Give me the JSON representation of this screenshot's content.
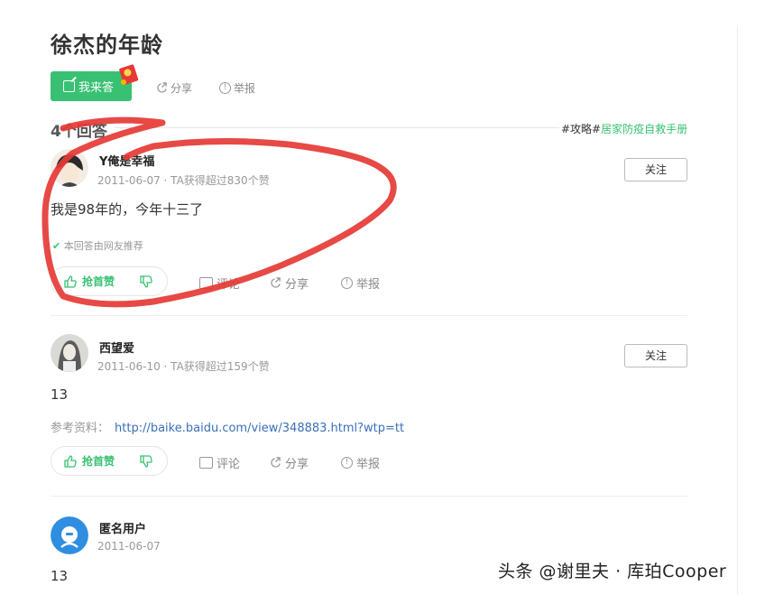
{
  "question": {
    "title": "徐杰的年龄",
    "answer_button": "我来答",
    "share": "分享",
    "report": "举报"
  },
  "answers_header": {
    "count": "4个回答",
    "tag_prefix": "#攻略#",
    "tag_link": "居家防疫自救手册"
  },
  "answers": [
    {
      "user": "Y俺是幸福",
      "meta": "2011-06-07 · TA获得超过830个赞",
      "follow": "关注",
      "content": "我是98年的，今年十三了",
      "note": "本回答由网友推荐",
      "vote_label": "抢首赞",
      "comment": "评论",
      "share": "分享",
      "report": "举报"
    },
    {
      "user": "西望爱",
      "meta": "2011-06-10 · TA获得超过159个赞",
      "follow": "关注",
      "content": "13",
      "ref_label": "参考资料：",
      "ref_link": "http://baike.baidu.com/view/348883.html?wtp=tt",
      "vote_label": "抢首赞",
      "comment": "评论",
      "share": "分享",
      "report": "举报"
    },
    {
      "user": "匿名用户",
      "meta": "2011-06-07",
      "content": "13"
    }
  ],
  "watermark": "头条 @谢里夫 · 库珀Cooper",
  "colors": {
    "brand_green": "#38c172",
    "link_blue": "#3b6fb6",
    "annotation_red": "#e53935"
  }
}
